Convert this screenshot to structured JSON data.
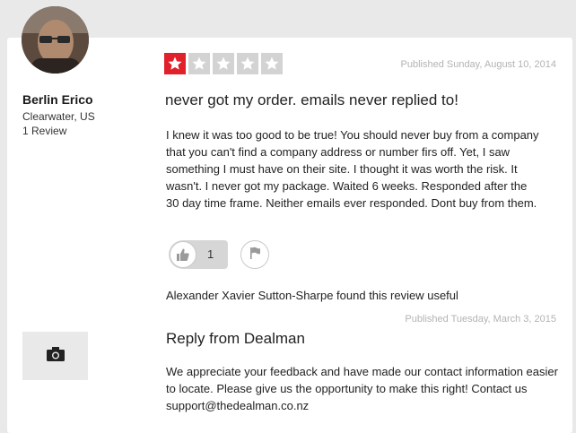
{
  "reviewer": {
    "name": "Berlin Erico",
    "location": "Clearwater, US",
    "review_count": "1 Review"
  },
  "review": {
    "rating": 1,
    "max_rating": 5,
    "published": "Published Sunday, August 10, 2014",
    "title": "never got my order. emails never replied to!",
    "body": "I knew it was too good to be true! You should never buy from a company that you can't find a company address or number firs off. Yet, I saw something I must have on their site. I thought it was worth the risk. It wasn't. I never got my package. Waited 6 weeks. Responded after the 30 day time frame. Neither emails ever responded. Dont buy from them.",
    "useful_count": "1",
    "found_useful": "Alexander Xavier Sutton-Sharpe found this review useful"
  },
  "reply": {
    "published": "Published Tuesday, March 3, 2015",
    "title": "Reply from Dealman",
    "body": "We appreciate your feedback and have made our contact information easier to locate. Please give us the opportunity to make this right! Contact us support@thedealman.co.nz"
  },
  "icons": {
    "useful": "thumbs-up-icon",
    "report": "flag-icon",
    "company_logo": "camera-icon",
    "star": "star-icon"
  },
  "colors": {
    "star_filled": "#e0212b",
    "star_empty": "#d3d3d3",
    "muted_text": "#b3b3b3"
  }
}
